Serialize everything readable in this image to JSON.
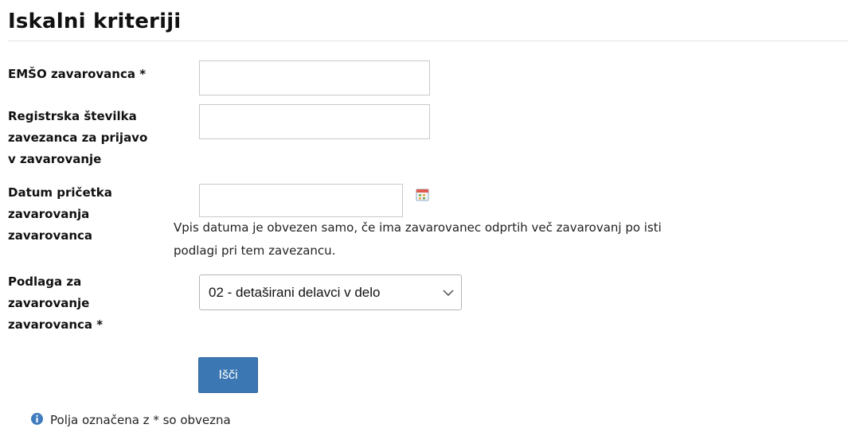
{
  "page": {
    "title": "Iskalni kriteriji"
  },
  "form": {
    "emso_label": "EMŠO zavarovanca *",
    "emso_value": "",
    "reg_label_lines": [
      "Registrska številka",
      "zavezanca za prijavo",
      "v zavarovanje"
    ],
    "reg_value": "",
    "date_label_lines": [
      "Datum pričetka",
      "zavarovanja",
      "zavarovanca"
    ],
    "date_value": "",
    "date_hint_lines": [
      "Vpis datuma je obvezen samo, če ima zavarovanec odprtih več zavarovanj po isti",
      "podlagi pri tem zavezancu."
    ],
    "basis_label_lines": [
      "Podlaga za",
      "zavarovanje",
      "zavarovanca *"
    ],
    "basis_selected": "02 - detaširani delavci v delo",
    "search_button": "Išči"
  },
  "footer": {
    "required_note": "Polja označena z * so obvezna"
  },
  "icons": {
    "calendar": "calendar-icon",
    "info": "info-icon",
    "dropdown": "chevron-down-icon"
  },
  "colors": {
    "button": "#3b78b3",
    "info": "#3f7bbf"
  }
}
